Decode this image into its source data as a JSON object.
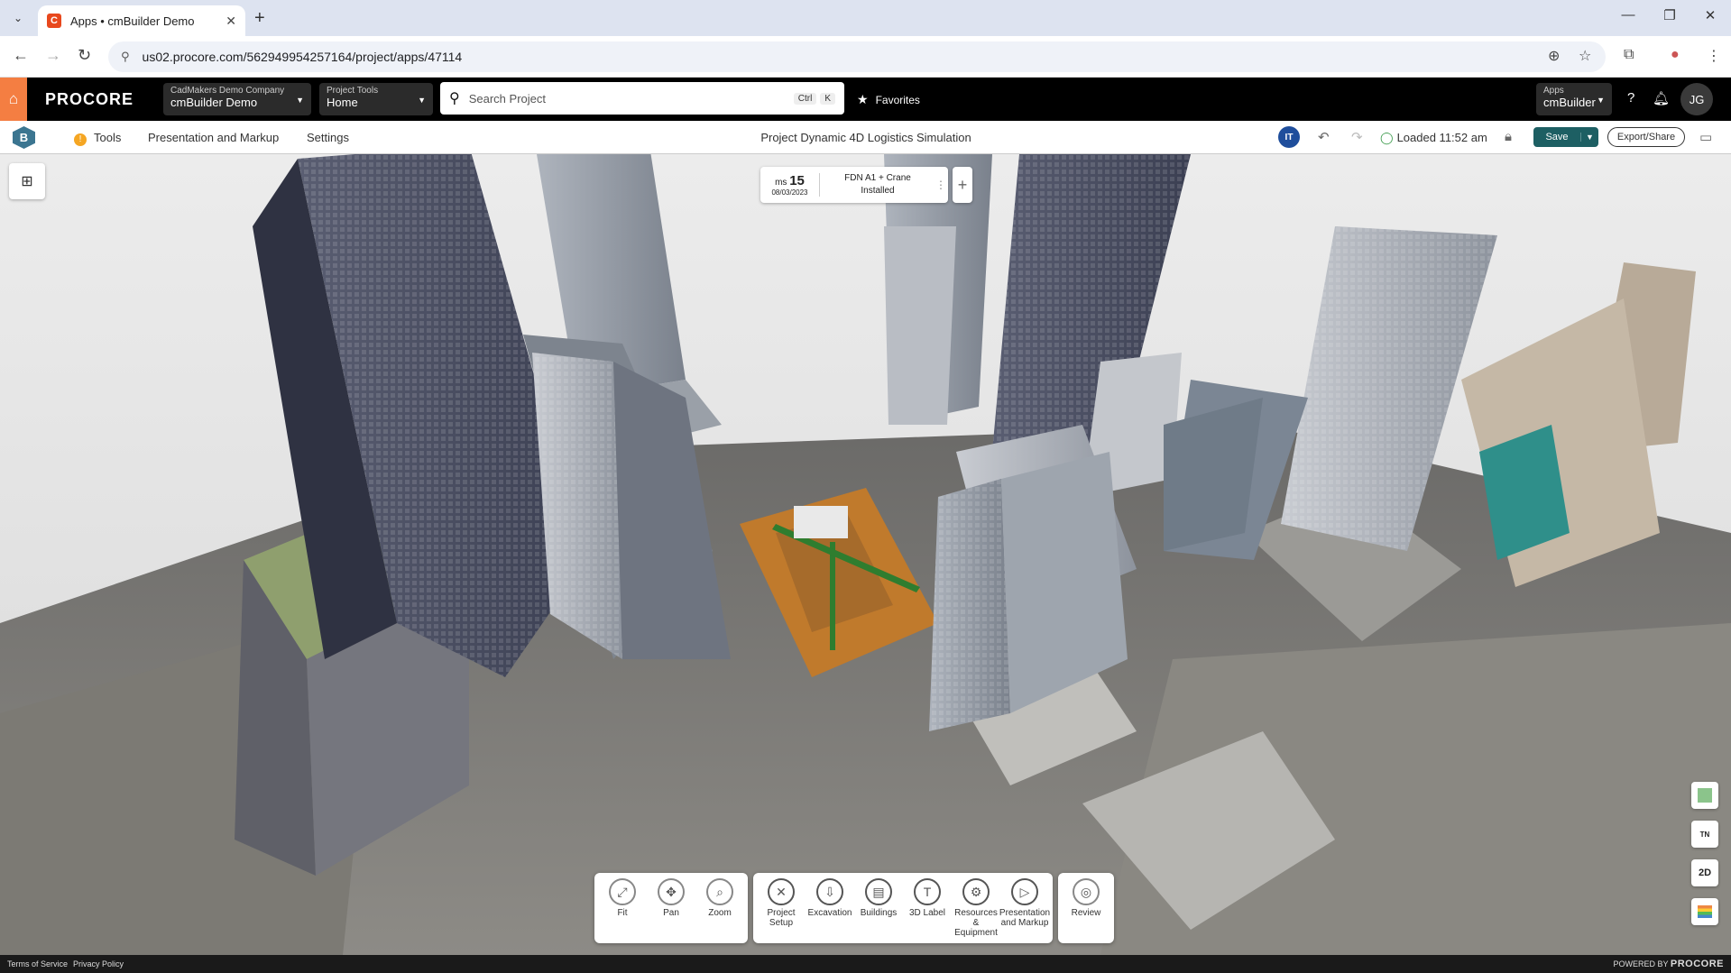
{
  "browser": {
    "tab_title": "Apps • cmBuilder Demo",
    "url": "us02.procore.com/562949954257164/project/apps/47114"
  },
  "header": {
    "logo": "PROCORE",
    "company_label": "CadMakers Demo Company",
    "company_value": "cmBuilder Demo",
    "tools_label": "Project Tools",
    "tools_value": "Home",
    "search_placeholder": "Search Project",
    "shortcut_ctrl": "Ctrl",
    "shortcut_k": "K",
    "favorites": "Favorites",
    "apps_label": "Apps",
    "apps_value": "cmBuilder",
    "avatar": "JG"
  },
  "appbar": {
    "logo": "B",
    "menu": [
      "Tools",
      "Presentation and Markup",
      "Settings"
    ],
    "title": "Project Dynamic 4D Logistics Simulation",
    "user_badge": "IT",
    "loaded": "Loaded 11:52 am",
    "save": "Save",
    "export": "Export/Share"
  },
  "milestone": {
    "prefix": "ms",
    "number": "15",
    "date": "08/03/2023",
    "text_line1": "FDN A1 + Crane",
    "text_line2": "Installed"
  },
  "view_tools": [
    {
      "label": "Fit",
      "icon": "fit-icon",
      "glyph": "⤢"
    },
    {
      "label": "Pan",
      "icon": "pan-icon",
      "glyph": "✥"
    },
    {
      "label": "Zoom",
      "icon": "zoom-icon",
      "glyph": "⌕"
    }
  ],
  "main_tools": [
    {
      "label1": "Project",
      "label2": "Setup",
      "icon": "project-setup-icon",
      "glyph": "✕"
    },
    {
      "label1": "Excavation",
      "label2": "",
      "icon": "excavation-icon",
      "glyph": "⇩"
    },
    {
      "label1": "Buildings",
      "label2": "",
      "icon": "buildings-icon",
      "glyph": "▤"
    },
    {
      "label1": "3D Label",
      "label2": "",
      "icon": "3d-label-icon",
      "glyph": "T"
    },
    {
      "label1": "Resources &",
      "label2": "Equipment",
      "icon": "resources-icon",
      "glyph": "⚙"
    },
    {
      "label1": "Presentation",
      "label2": "and Markup",
      "icon": "presentation-icon",
      "glyph": "▷"
    }
  ],
  "review_tool": {
    "label": "Review",
    "icon": "review-icon",
    "glyph": "◎"
  },
  "side_tools": [
    "",
    "TN",
    "2D",
    ""
  ],
  "footer": {
    "terms": "Terms of Service",
    "privacy": "Privacy Policy",
    "powered": "POWERED BY",
    "brand": "PROCORE"
  }
}
